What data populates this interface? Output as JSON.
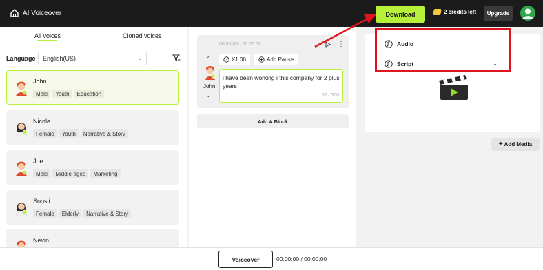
{
  "app": {
    "title": "AI Voiceover",
    "home_icon": "home-icon"
  },
  "header": {
    "download_label": "Download",
    "credits_text": "2 credits left",
    "upgrade_label": "Upgrade",
    "accent_color": "#b6f23a",
    "bar_color": "#1b1b1b"
  },
  "left": {
    "tabs": [
      {
        "label": "All voices"
      },
      {
        "label": "Cloned voices"
      }
    ],
    "language_label": "Language",
    "language_value": "English(US)",
    "voices": [
      {
        "name": "John",
        "tags": [
          "Male",
          "Youth",
          "Education"
        ]
      },
      {
        "name": "Nicole",
        "tags": [
          "Female",
          "Youth",
          "Narrative & Story"
        ]
      },
      {
        "name": "Joe",
        "tags": [
          "Male",
          "Middle-aged",
          "Marketing"
        ]
      },
      {
        "name": "Soosii",
        "tags": [
          "Female",
          "Elderly",
          "Narrative & Story"
        ]
      },
      {
        "name": "Nevin",
        "tags": []
      }
    ]
  },
  "editor": {
    "timecode": "00:00:00 - 00:00:00",
    "speed_label": "X1.00",
    "pause_label": "Add Pause",
    "speaker_name": "John",
    "text": "i have been working i this company for 2 plus years",
    "char_count": "52 / 500",
    "add_block_label": "Add A Block"
  },
  "media": {
    "add_media_label": "Add Media"
  },
  "dropdown": {
    "items": [
      {
        "label": "Audio"
      },
      {
        "label": "Script"
      }
    ],
    "highlight_color": "#e0141e"
  },
  "footer": {
    "voiceover_label": "Voiceover",
    "time": "00:00:00 / 00:00:00"
  }
}
